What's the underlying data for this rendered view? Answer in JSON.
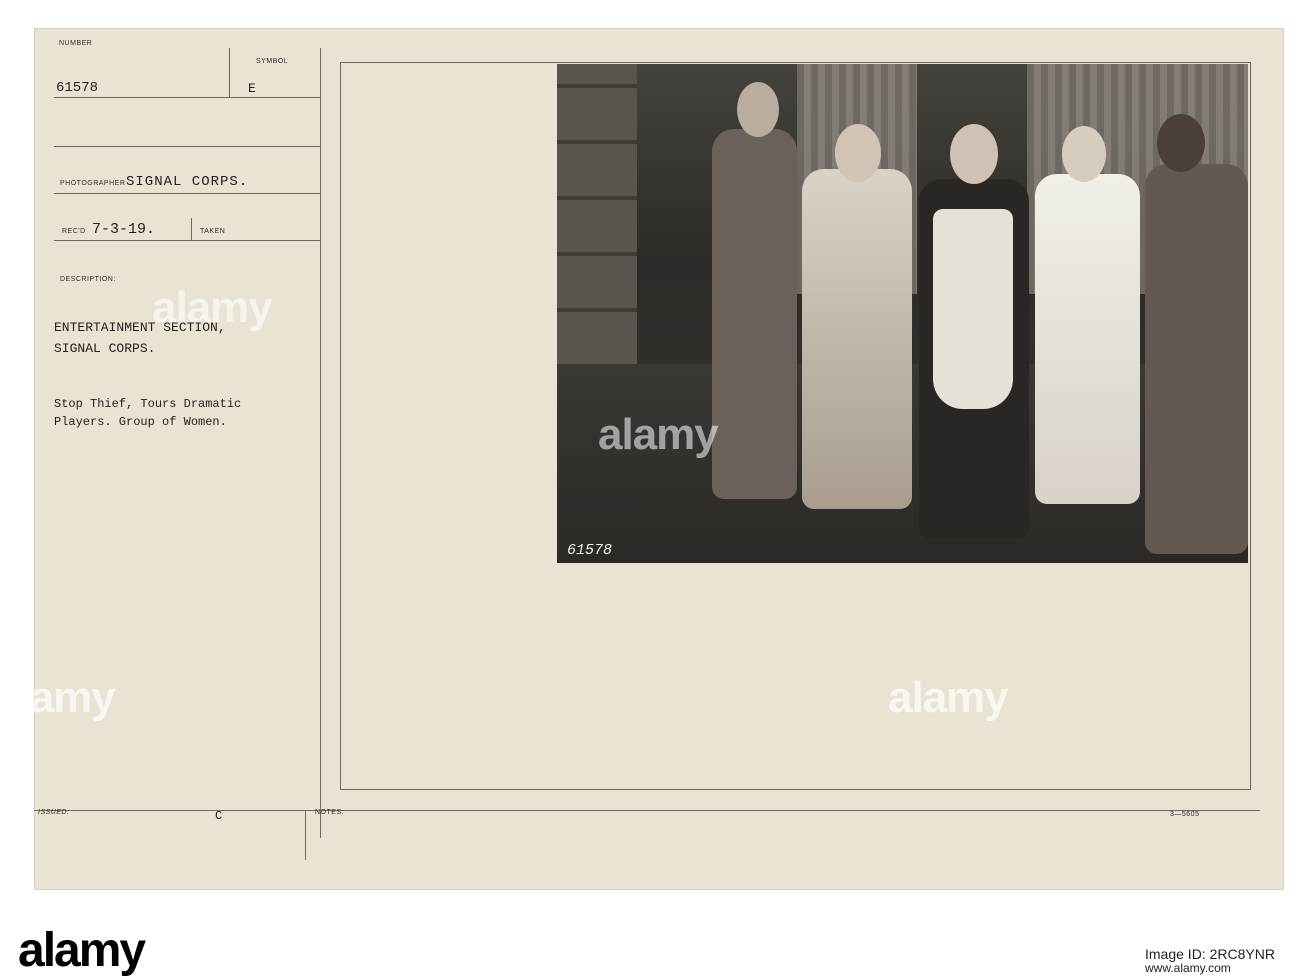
{
  "card": {
    "number_label": "NUMBER",
    "number": "61578",
    "symbol_label": "SYMBOL",
    "symbol": "E",
    "photographer_label": "PHOTOGRAPHER",
    "photographer": "SIGNAL CORPS.",
    "recd_label": "REC'D",
    "recd": "7-3-19.",
    "taken_label": "TAKEN",
    "description_label": "DESCRIPTION:",
    "description_line1": "ENTERTAINMENT SECTION,",
    "description_line2": "SIGNAL CORPS.",
    "caption_line1": "Stop Thief, Tours Dramatic",
    "caption_line2": "Players. Group of Women.",
    "issued_label": "ISSUED:",
    "issued_mark": "C",
    "notes_label": "NOTES:",
    "form_number": "3—5605"
  },
  "photo": {
    "negative_number": "61578"
  },
  "watermark": {
    "text": "alamy"
  },
  "footer": {
    "logo": "alamy",
    "image_id": "Image ID: 2RC8YNR",
    "url": "www.alamy.com"
  }
}
